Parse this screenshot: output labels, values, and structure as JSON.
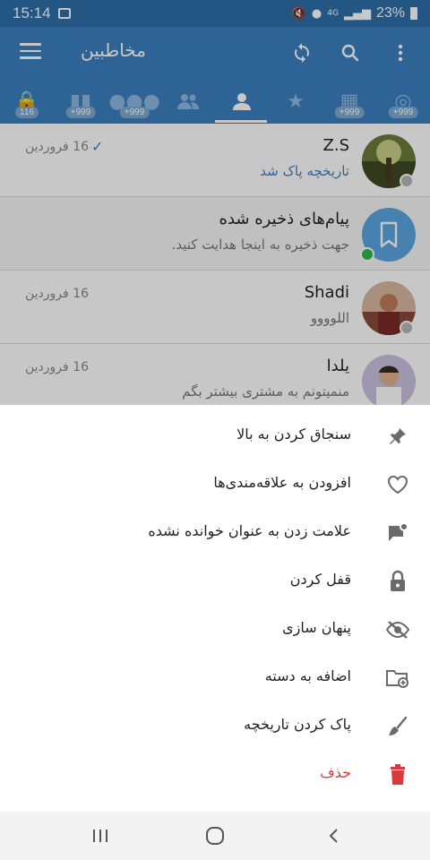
{
  "status_bar": {
    "time": "15:14",
    "network": "4G",
    "battery": "23%"
  },
  "toolbar": {
    "title": "مخاطبین",
    "menu_icon": "hamburger-icon",
    "sync_icon": "sync-icon",
    "search_icon": "search-icon",
    "more_icon": "more-vert-icon"
  },
  "tabs": [
    {
      "icon": "bot-icon",
      "badge": "116"
    },
    {
      "icon": "channel-icon",
      "badge": "+999"
    },
    {
      "icon": "groups-icon",
      "badge": "+999"
    },
    {
      "icon": "contacts-icon",
      "badge": ""
    },
    {
      "icon": "user-icon",
      "badge": "",
      "active": true
    },
    {
      "icon": "star-icon",
      "badge": ""
    },
    {
      "icon": "all-chats-icon",
      "badge": "+999"
    },
    {
      "icon": "unread-icon",
      "badge": "+999"
    }
  ],
  "chats": [
    {
      "name": "Z.S",
      "preview": "تاریخچه پاک شد",
      "date": "16 فروردین",
      "read": true
    },
    {
      "name": "پیام‌های ذخیره شده",
      "preview": "جهت ذخیره به اینجا هدایت کنید.",
      "date": ""
    },
    {
      "name": "Shadi",
      "preview": "اللوووو",
      "date": "16 فروردین"
    },
    {
      "name": "یلدا",
      "preview": "منمیتونم به مشتری بیشتر بگم",
      "date": "16 فروردین"
    }
  ],
  "sheet": {
    "items": [
      {
        "label": "سنجاق کردن به بالا",
        "icon": "pin-icon"
      },
      {
        "label": "افزودن به علاقه‌مندی‌ها",
        "icon": "heart-icon"
      },
      {
        "label": "علامت زدن به عنوان خوانده نشده",
        "icon": "mark-unread-icon"
      },
      {
        "label": "قفل کردن",
        "icon": "lock-icon"
      },
      {
        "label": "پنهان سازی",
        "icon": "hide-icon"
      },
      {
        "label": "اضافه به دسته",
        "icon": "add-folder-icon"
      },
      {
        "label": "پاک کردن تاریخچه",
        "icon": "clear-history-icon"
      },
      {
        "label": "حذف",
        "icon": "trash-icon",
        "danger": true
      }
    ]
  },
  "colors": {
    "primary": "#3b80bf",
    "status_bar": "#2e6fa8",
    "danger": "#d83b3b",
    "online": "#2eb84b"
  }
}
